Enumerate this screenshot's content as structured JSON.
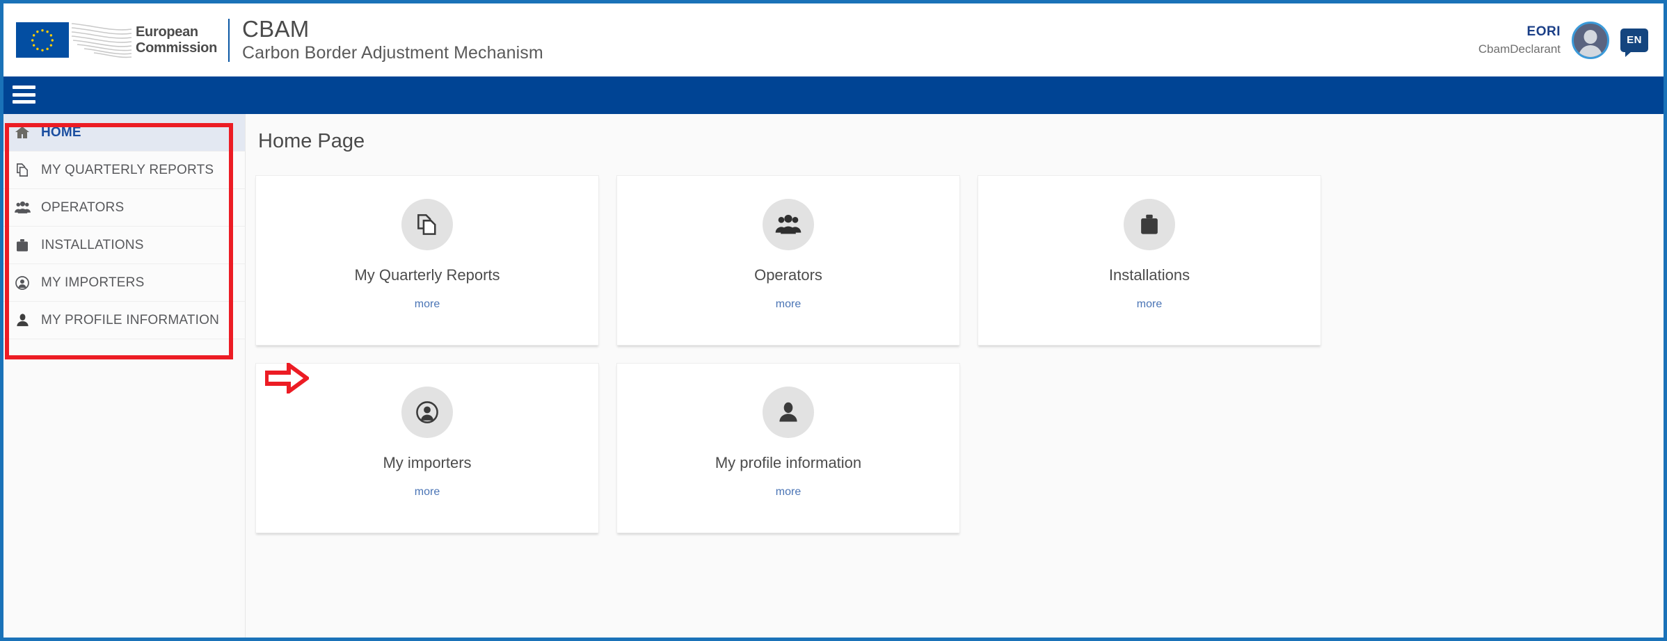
{
  "header": {
    "org_line1": "European",
    "org_line2": "Commission",
    "app_title": "CBAM",
    "app_subtitle": "Carbon Border Adjustment Mechanism",
    "eori_label": "EORI",
    "eori_value": "CbamDeclarant",
    "language": "EN",
    "avatar_name": "avatar",
    "brand_blue": "#004494",
    "frame_blue": "#1a72b8",
    "annotation_red": "#ec1c24"
  },
  "navbar": {
    "menu_icon": "hamburger-icon"
  },
  "sidebar": {
    "items": [
      {
        "label": "HOME",
        "icon": "home-icon",
        "active": true
      },
      {
        "label": "MY QUARTERLY REPORTS",
        "icon": "copy-documents-icon",
        "active": false
      },
      {
        "label": "OPERATORS",
        "icon": "users-group-icon",
        "active": false
      },
      {
        "label": "INSTALLATIONS",
        "icon": "briefcase-icon",
        "active": false
      },
      {
        "label": "MY IMPORTERS",
        "icon": "user-circle-icon",
        "active": false
      },
      {
        "label": "MY PROFILE INFORMATION",
        "icon": "person-icon",
        "active": false
      }
    ]
  },
  "main": {
    "page_title": "Home Page",
    "more_label": "more",
    "cards": [
      {
        "label": "My Quarterly Reports",
        "icon": "copy-documents-icon",
        "more": "more"
      },
      {
        "label": "Operators",
        "icon": "users-group-icon",
        "more": "more"
      },
      {
        "label": "Installations",
        "icon": "briefcase-icon",
        "more": "more"
      },
      {
        "label": "My importers",
        "icon": "user-circle-icon",
        "more": "more"
      },
      {
        "label": "My profile information",
        "icon": "person-icon",
        "more": "more"
      }
    ]
  },
  "annotations": {
    "sidebar_highlight": "red-rectangle-around-sidebar-menu",
    "arrow_target": "My Quarterly Reports"
  }
}
